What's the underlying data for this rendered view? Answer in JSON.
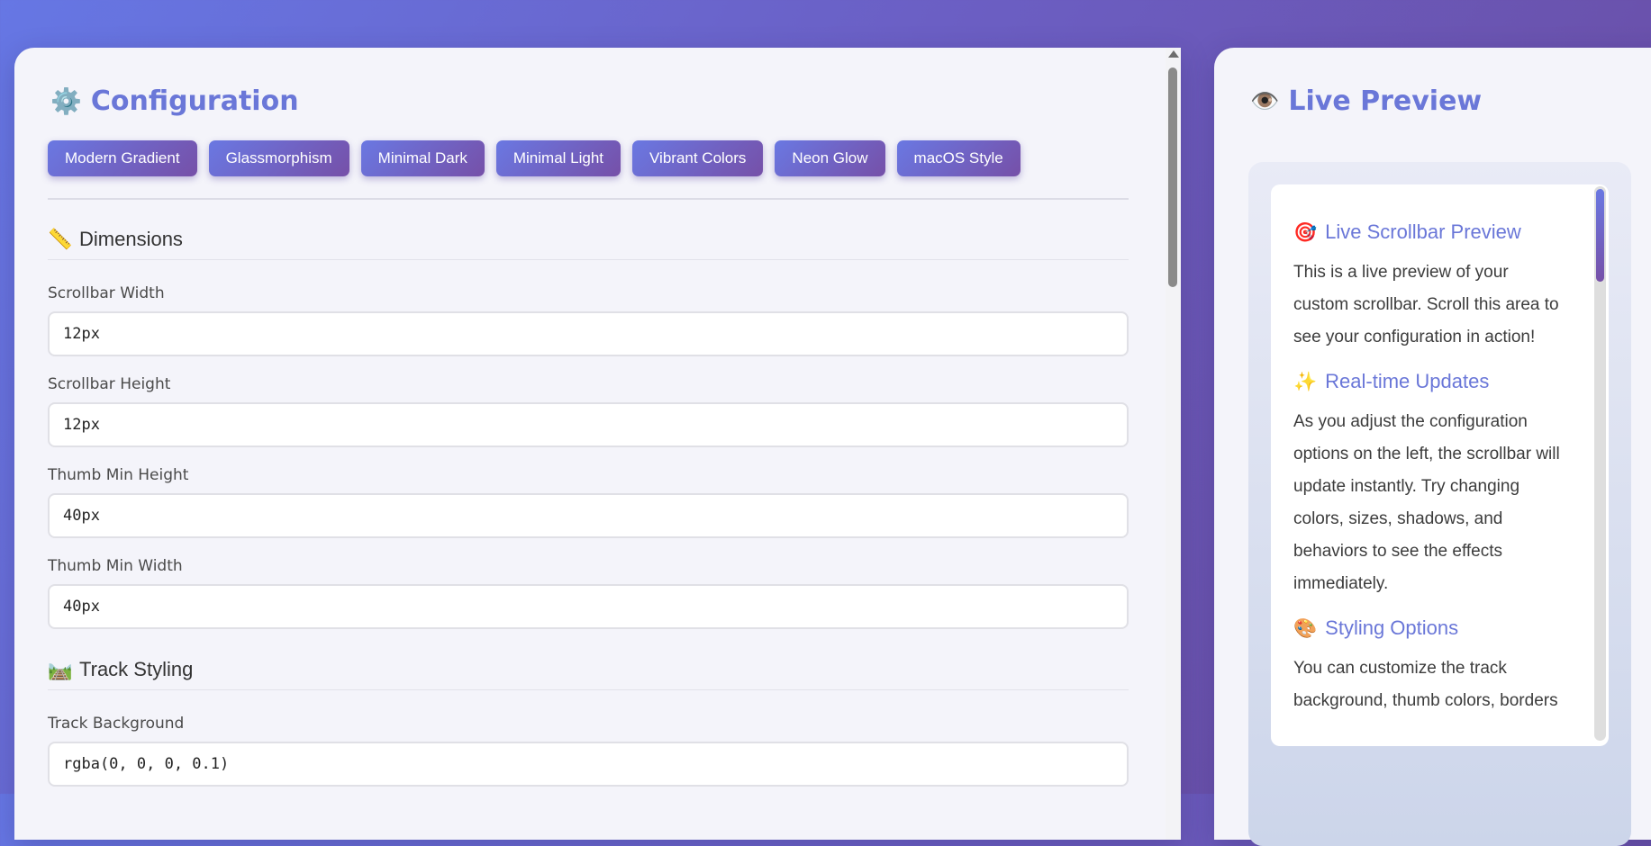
{
  "config": {
    "title": "Configuration",
    "title_icon": "⚙️",
    "presets": [
      "Modern Gradient",
      "Glassmorphism",
      "Minimal Dark",
      "Minimal Light",
      "Vibrant Colors",
      "Neon Glow",
      "macOS Style"
    ],
    "dimensions": {
      "heading": "Dimensions",
      "icon": "📏",
      "fields": [
        {
          "label": "Scrollbar Width",
          "value": "12px"
        },
        {
          "label": "Scrollbar Height",
          "value": "12px"
        },
        {
          "label": "Thumb Min Height",
          "value": "40px"
        },
        {
          "label": "Thumb Min Width",
          "value": "40px"
        }
      ]
    },
    "track": {
      "heading": "Track Styling",
      "icon": "🛤️",
      "fields": [
        {
          "label": "Track Background",
          "value": "rgba(0, 0, 0, 0.1)"
        }
      ]
    }
  },
  "preview": {
    "title": "Live Preview",
    "title_icon": "👁️",
    "sections": [
      {
        "icon": "🎯",
        "heading": "Live Scrollbar Preview",
        "text": "This is a live preview of your custom scrollbar. Scroll this area to see your configuration in action!"
      },
      {
        "icon": "✨",
        "heading": "Real-time Updates",
        "text": "As you adjust the configuration options on the left, the scrollbar will update instantly. Try changing colors, sizes, shadows, and behaviors to see the effects immediately."
      },
      {
        "icon": "🎨",
        "heading": "Styling Options",
        "text": "You can customize the track background, thumb colors, borders"
      }
    ]
  },
  "colors": {
    "accent": "#6a77d8",
    "gradient_start": "#6a78e2",
    "gradient_end": "#7650a8"
  }
}
